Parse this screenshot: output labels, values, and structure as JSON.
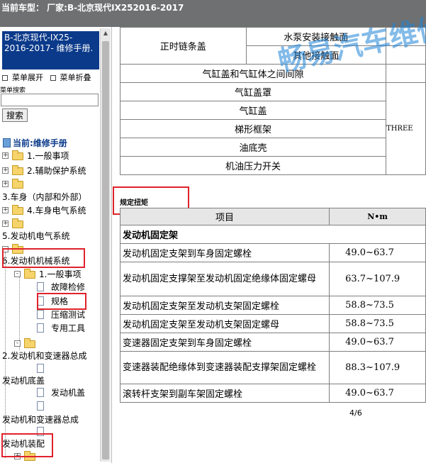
{
  "header": {
    "title": "当前车型： 厂家:B-北京现代IX252016-2017"
  },
  "sidebar": {
    "manual_title": "B-北京现代-IX25-2016-2017- 维修手册.",
    "expand_label": "菜单展开",
    "collapse_label": "菜单折叠",
    "search_label": "菜单搜索",
    "search_value": "",
    "search_button": "搜索",
    "current_label": "当前:维修手册",
    "items": [
      {
        "label": "1.一般事项"
      },
      {
        "label": "2.辅助保护系统"
      },
      {
        "label": "3.车身（内部和外部）"
      },
      {
        "label": "4.车身电气系统"
      },
      {
        "label": "5.发动机电气系统"
      },
      {
        "label": "6.发动机机械系统"
      },
      {
        "label": "1.一般事项"
      },
      {
        "label": "故障检修"
      },
      {
        "label": "规格"
      },
      {
        "label": "压缩测试"
      },
      {
        "label": "专用工具"
      },
      {
        "label": "2.发动机和变速器总成"
      },
      {
        "label": "发动机底盖"
      },
      {
        "label": "发动机盖"
      },
      {
        "label": "发动机和变速器总成"
      },
      {
        "label": "发动机装配"
      }
    ]
  },
  "upper_table": {
    "rows": [
      {
        "a": "正时链条盖",
        "b": "水泵安装接触面"
      },
      {
        "b": "其他接触面"
      },
      {
        "a": "气缸盖和气缸体之间间隙"
      },
      {
        "a": "气缸盖罩"
      },
      {
        "a": "气缸盖",
        "c": "THREE"
      },
      {
        "a": "梯形框架"
      },
      {
        "a": "油底壳"
      },
      {
        "a": "机油压力开关"
      }
    ]
  },
  "section_title": "规定扭矩",
  "torque_table": {
    "headers": [
      "项目",
      "N•m"
    ],
    "group": "发动机固定架",
    "rows": [
      {
        "item": "发动机固定支架到车身固定螺栓",
        "nm": "49.0~63.7"
      },
      {
        "item": "发动机固定支撑架至发动机固定绝缘体固定螺母",
        "nm": "63.7~107.9"
      },
      {
        "item": "发动机固定支架至发动机支架固定螺栓",
        "nm": "58.8~73.5"
      },
      {
        "item": "发动机固定支架至发动机支架固定螺母",
        "nm": "58.8~73.5"
      },
      {
        "item": "变速器固定支架到车身固定螺栓",
        "nm": "49.0~63.7"
      },
      {
        "item": "变速器装配绝缘体到变速器装配支撑架固定螺栓",
        "nm": "88.3~107.9"
      },
      {
        "item": "滚转杆支架到副车架固定螺栓",
        "nm": "49.0~63.7"
      }
    ]
  },
  "watermark": "畅易汽车维修",
  "page_indicator": "4/6"
}
